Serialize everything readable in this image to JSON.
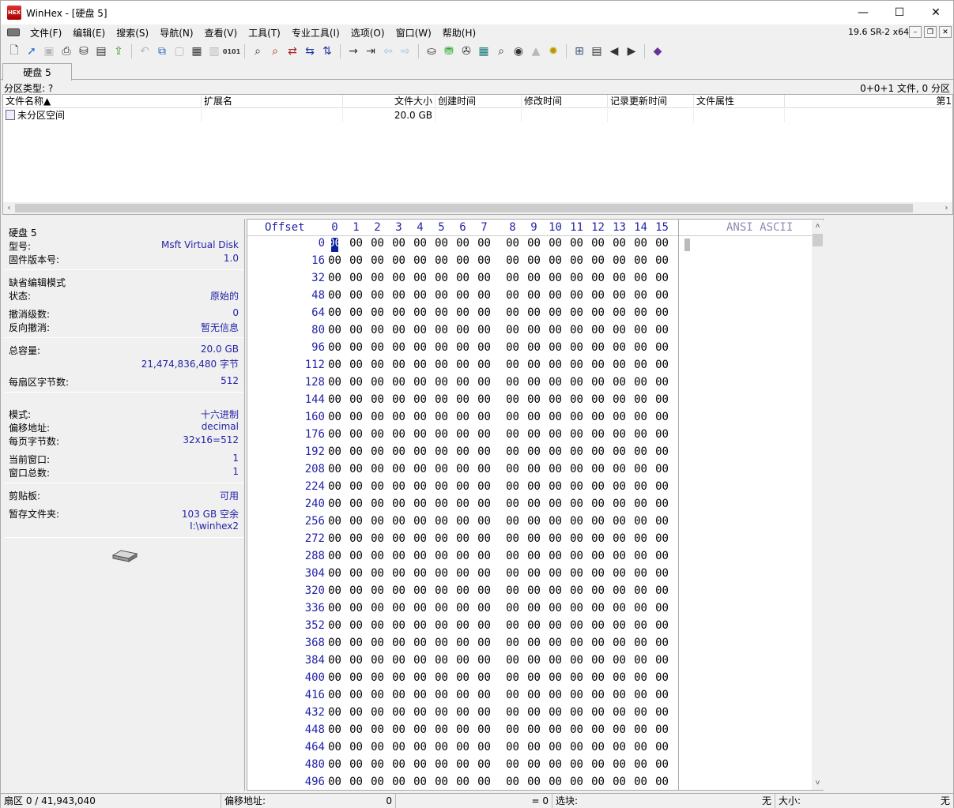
{
  "window": {
    "title": "WinHex - [硬盘 5]",
    "logo_text": "HEX",
    "minimize": "—",
    "maximize": "☐",
    "close": "✕"
  },
  "menu": {
    "items": [
      "文件(F)",
      "编辑(E)",
      "搜索(S)",
      "导航(N)",
      "查看(V)",
      "工具(T)",
      "专业工具(I)",
      "选项(O)",
      "窗口(W)",
      "帮助(H)"
    ],
    "version": "19.6 SR-2 x64",
    "mdi_min": "–",
    "mdi_restore": "❐",
    "mdi_close": "✕"
  },
  "toolbar": {
    "groups": [
      [
        "new-file-icon",
        "open-file-icon",
        "save-icon",
        "print-icon",
        "open-disk-icon",
        "properties-icon",
        "export-icon"
      ],
      [
        "undo-icon",
        "copy-icon",
        "cut-icon",
        "paste-icon",
        "paste-block-icon",
        "hex-binary-icon"
      ],
      [
        "find-text-icon",
        "find-hex-icon",
        "replace-text-icon",
        "replace-hex-icon",
        "find-hex-value-icon"
      ],
      [
        "goto-offset-icon",
        "goto-sector-icon",
        "back-icon",
        "forward-icon"
      ],
      [
        "disk-edit-icon",
        "ram-edit-icon",
        "disk-tools-icon",
        "calculator-icon",
        "hash-icon",
        "analyze-icon",
        "clone-icon",
        "settings-icon"
      ],
      [
        "data-interpreter-icon",
        "template-icon",
        "sector-prev-icon",
        "sector-next-icon"
      ],
      [
        "help-book-icon"
      ]
    ]
  },
  "tab": {
    "label": "硬盘 5"
  },
  "partition": {
    "type_label": "分区类型: ?",
    "summary": "0+0+1 文件, 0 分区"
  },
  "filelist": {
    "columns": [
      "文件名称▲",
      "扩展名",
      "文件大小",
      "创建时间",
      "修改时间",
      "记录更新时间",
      "文件属性",
      "第1"
    ],
    "rows": [
      {
        "name": "未分区空间",
        "ext": "",
        "size": "20.0 GB",
        "created": "",
        "modified": "",
        "updated": "",
        "attr": ""
      }
    ]
  },
  "info": {
    "disk_title": "硬盘 5",
    "model_label": "型号:",
    "model_value": "Msft Virtual Disk",
    "fw_label": "固件版本号:",
    "fw_value": "1.0",
    "edit_mode_label": "缺省编辑模式",
    "state_label": "状态:",
    "state_value": "原始的",
    "undo_label": "撤消级数:",
    "undo_value": "0",
    "redo_label": "反向撤消:",
    "redo_value": "暂无信息",
    "capacity_label": "总容量:",
    "capacity_value": "20.0 GB",
    "capacity_bytes": "21,474,836,480 字节",
    "bps_label": "每扇区字节数:",
    "bps_value": "512",
    "mode_label": "模式:",
    "mode_value": "十六进制",
    "offset_label": "偏移地址:",
    "offset_value": "decimal",
    "bpp_label": "每页字节数:",
    "bpp_value": "32x16=512",
    "curwin_label": "当前窗口:",
    "curwin_value": "1",
    "totwin_label": "窗口总数:",
    "totwin_value": "1",
    "clip_label": "剪贴板:",
    "clip_value": "可用",
    "temp_label": "暂存文件夹:",
    "temp_value": "103 GB 空余",
    "temp_path": "I:\\winhex2"
  },
  "hex": {
    "offset_label": "Offset",
    "columns": [
      "0",
      "1",
      "2",
      "3",
      "4",
      "5",
      "6",
      "7",
      "8",
      "9",
      "10",
      "11",
      "12",
      "13",
      "14",
      "15"
    ],
    "ascii_label": "ANSI ASCII",
    "offsets": [
      "0",
      "16",
      "32",
      "48",
      "64",
      "80",
      "96",
      "112",
      "128",
      "144",
      "160",
      "176",
      "192",
      "208",
      "224",
      "240",
      "256",
      "272",
      "288",
      "304",
      "320",
      "336",
      "352",
      "368",
      "384",
      "400",
      "416",
      "432",
      "448",
      "464",
      "480",
      "496"
    ],
    "byte_value": "00"
  },
  "status": {
    "sector": "扇区 0 / 41,943,040",
    "offset_label": "偏移地址:",
    "offset_value": "0",
    "equals": "= 0",
    "block_label": "选块:",
    "block_value": "无",
    "size_label": "大小:",
    "size_value": "无"
  }
}
